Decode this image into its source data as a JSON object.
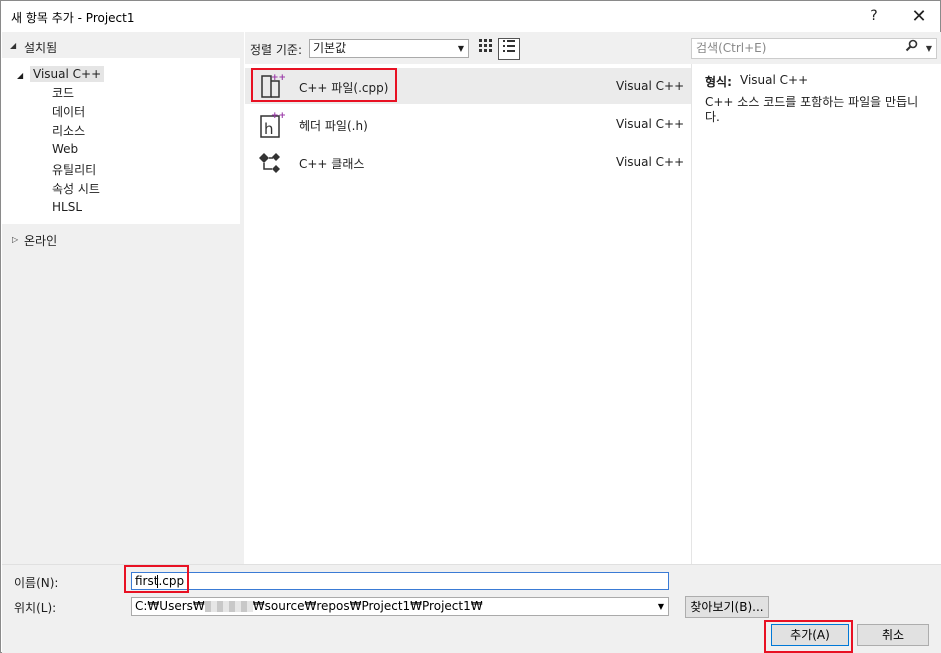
{
  "window": {
    "title": "새 항목 추가 - Project1",
    "help": "?",
    "close": "✕"
  },
  "left": {
    "installed": "설치됨",
    "tree": {
      "root": "Visual C++",
      "children": [
        "코드",
        "데이터",
        "리소스",
        "Web",
        "유틸리티",
        "속성 시트",
        "HLSL"
      ]
    },
    "online": "온라인"
  },
  "toolbar": {
    "sort_label": "정렬 기준:",
    "sort_value": "기본값"
  },
  "search": {
    "placeholder": "검색(Ctrl+E)"
  },
  "templates": [
    {
      "name": "C++ 파일(.cpp)",
      "lang": "Visual C++",
      "icon": "cpp-file-icon"
    },
    {
      "name": "헤더 파일(.h)",
      "lang": "Visual C++",
      "icon": "header-file-icon"
    },
    {
      "name": "C++ 클래스",
      "lang": "Visual C++",
      "icon": "cpp-class-icon"
    }
  ],
  "details": {
    "type_label": "형식:",
    "type_value": "Visual C++",
    "description": "C++ 소스 코드를 포함하는 파일을 만듭니다."
  },
  "form": {
    "name_label": "이름(N):",
    "name_value_a": "first",
    "name_value_b": ".cpp",
    "location_label": "위치(L):",
    "location_a": "C:₩Users₩",
    "location_b": "₩source₩repos₩Project1₩Project1₩",
    "browse": "찾아보기(B)...",
    "add": "추가(A)",
    "cancel": "취소"
  },
  "colors": {
    "highlight": "#e81123",
    "accent": "#0078d7"
  }
}
